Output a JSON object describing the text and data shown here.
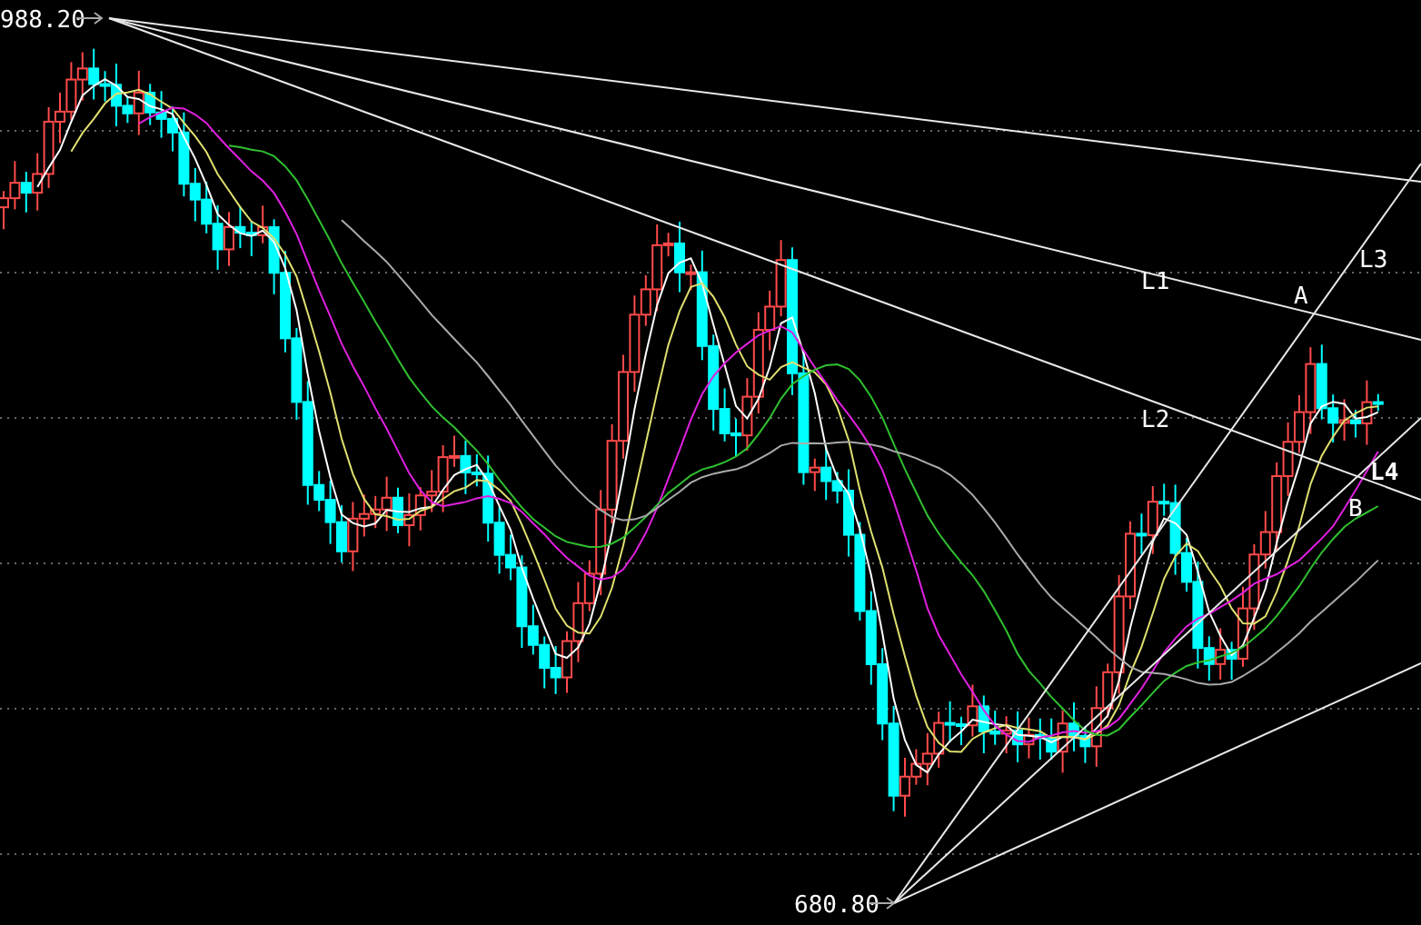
{
  "chart": {
    "price_labels": [
      {
        "kind": "high",
        "text": "988.20"
      },
      {
        "kind": "low",
        "text": "680.80"
      }
    ],
    "line_labels": [
      "L1",
      "L2",
      "L3",
      "L4"
    ],
    "point_labels": [
      "A",
      "B"
    ]
  }
}
